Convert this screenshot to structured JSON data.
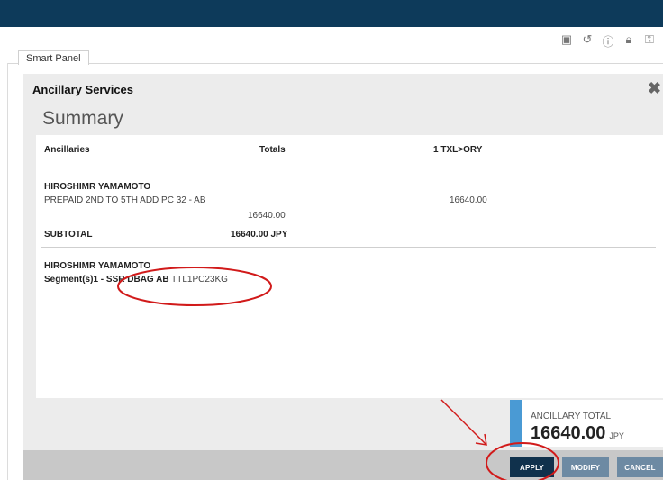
{
  "toolbar": {
    "icons": [
      "cube-icon",
      "cube-refresh-icon",
      "help-icon",
      "lock-icon",
      "key-icon"
    ]
  },
  "tab": {
    "label": "Smart Panel"
  },
  "panel": {
    "title": "Ancillary Services",
    "summary_heading": "Summary"
  },
  "table": {
    "headers": {
      "ancillaries": "Ancillaries",
      "totals": "Totals",
      "segment": "1 TXL>ORY"
    },
    "passenger_name": "HIROSHIMR YAMAMOTO",
    "item_desc": "PREPAID 2ND TO 5TH ADD PC 32 - AB",
    "item_total": "16640.00",
    "item_segment_amount": "16640.00",
    "subtotal_label": "SUBTOTAL",
    "subtotal_value": "16640.00 JPY"
  },
  "ssr": {
    "passenger_name": "HIROSHIMR YAMAMOTO",
    "segment_label": "Segment(s)1",
    "dash": " - ",
    "code": "SSR DBAG AB",
    "free_text": "TTL1PC23KG"
  },
  "ancillary_total": {
    "label": "ANCILLARY TOTAL",
    "amount": "16640.00",
    "currency": "JPY"
  },
  "buttons": {
    "apply": "APPLY",
    "modify": "MODIFY",
    "cancel": "CANCEL"
  },
  "colors": {
    "topbar": "#0d3a5a",
    "accent_bar": "#4a9ad4",
    "apply_button": "#10314c",
    "secondary_button": "#6d8aa3",
    "annotation": "#d11a1a"
  }
}
